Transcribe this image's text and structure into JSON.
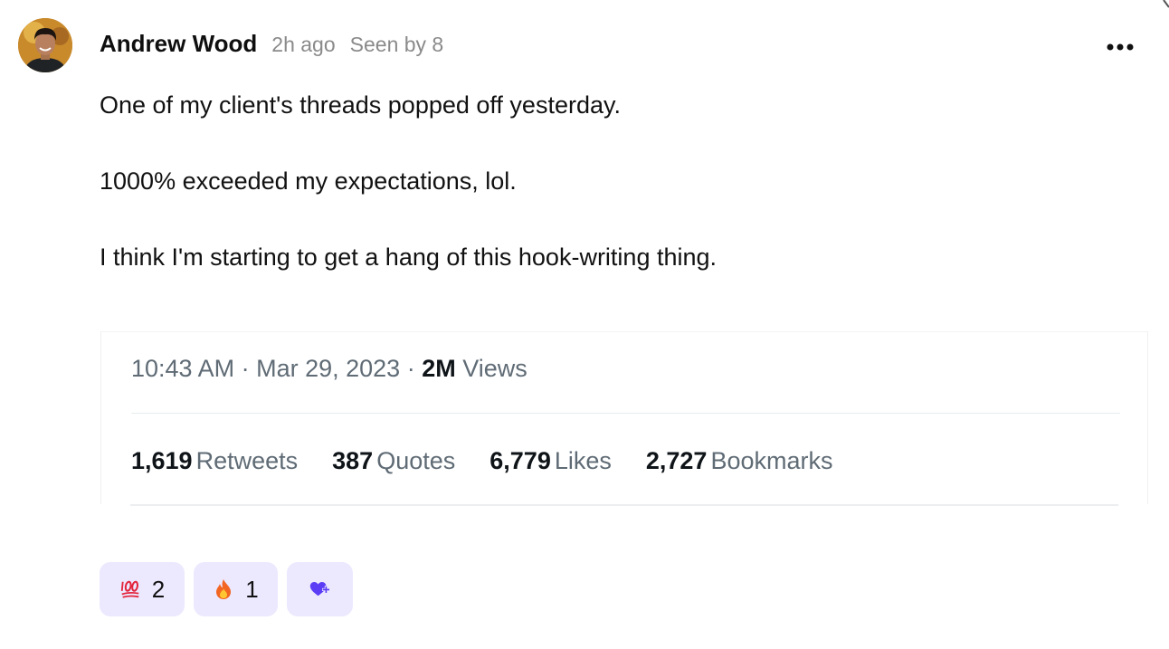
{
  "post": {
    "author": "Andrew Wood",
    "time_ago": "2h ago",
    "seen_by": "Seen by 8",
    "lines": [
      "One of my client's threads popped off yesterday.",
      "1000% exceeded my expectations, lol.",
      "I think I'm starting to get a hang of this hook-writing thing."
    ]
  },
  "embed": {
    "time": "10:43 AM",
    "separator": " · ",
    "date": "Mar 29, 2023",
    "views_count": "2M",
    "views_label": " Views",
    "stats": [
      {
        "count": "1,619",
        "label": "Retweets"
      },
      {
        "count": "387",
        "label": "Quotes"
      },
      {
        "count": "6,779",
        "label": "Likes"
      },
      {
        "count": "2,727",
        "label": "Bookmarks"
      }
    ]
  },
  "reactions": [
    {
      "icon": "hundred-points-icon",
      "count": "2"
    },
    {
      "icon": "fire-icon",
      "count": "1"
    },
    {
      "icon": "add-reaction-heart-icon"
    }
  ],
  "colors": {
    "reaction_bg": "#ece9ff",
    "add_reaction_accent": "#5b3df5",
    "muted_text": "#8a8a8a",
    "embed_muted_text": "#5f6b75"
  }
}
